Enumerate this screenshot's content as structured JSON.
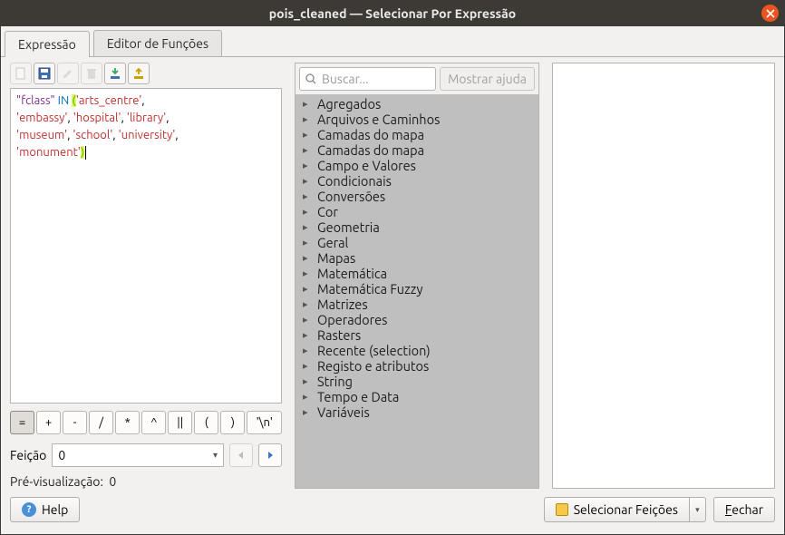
{
  "window": {
    "title": "pois_cleaned — Selecionar Por Expressão"
  },
  "tabs": [
    {
      "label": "Expressão",
      "active": true
    },
    {
      "label": "Editor de Funções",
      "active": false
    }
  ],
  "expression_tokens": [
    {
      "t": "field",
      "v": "\"fclass\""
    },
    {
      "t": "sp",
      "v": " "
    },
    {
      "t": "kw",
      "v": "IN"
    },
    {
      "t": "sp",
      "v": " "
    },
    {
      "t": "paren",
      "v": "("
    },
    {
      "t": "str",
      "v": "'arts_centre'"
    },
    {
      "t": "plain",
      "v": ","
    },
    {
      "t": "br"
    },
    {
      "t": "str",
      "v": "'embassy'"
    },
    {
      "t": "plain",
      "v": ", "
    },
    {
      "t": "str",
      "v": "'hospital'"
    },
    {
      "t": "plain",
      "v": ", "
    },
    {
      "t": "str",
      "v": "'library'"
    },
    {
      "t": "plain",
      "v": ","
    },
    {
      "t": "br"
    },
    {
      "t": "str",
      "v": "'museum'"
    },
    {
      "t": "plain",
      "v": ", "
    },
    {
      "t": "str",
      "v": "'school'"
    },
    {
      "t": "plain",
      "v": ", "
    },
    {
      "t": "str",
      "v": "'university'"
    },
    {
      "t": "plain",
      "v": ","
    },
    {
      "t": "br"
    },
    {
      "t": "str",
      "v": "'monument'"
    },
    {
      "t": "paren",
      "v": ")"
    }
  ],
  "operator_buttons": [
    "=",
    "+",
    "-",
    "/",
    "*",
    "^",
    "||",
    "(",
    ")",
    "'\\n'"
  ],
  "feature": {
    "label": "Feição",
    "value": "0"
  },
  "preview": {
    "label": "Pré-visualização:",
    "value": "0"
  },
  "search": {
    "placeholder": "Buscar..."
  },
  "show_help_label": "Mostrar ajuda",
  "tree": [
    "Agregados",
    "Arquivos e Caminhos",
    "Camadas do mapa",
    "Camadas do mapa",
    "Campo e Valores",
    "Condicionais",
    "Conversões",
    "Cor",
    "Geometria",
    "Geral",
    "Mapas",
    "Matemática",
    "Matemática Fuzzy",
    "Matrizes",
    "Operadores",
    "Rasters",
    "Recente (selection)",
    "Registo e atributos",
    "String",
    "Tempo e Data",
    "Variáveis"
  ],
  "footer": {
    "help": "Help",
    "select": "Selecionar Feições",
    "close_prefix": "F",
    "close_rest": "echar"
  }
}
